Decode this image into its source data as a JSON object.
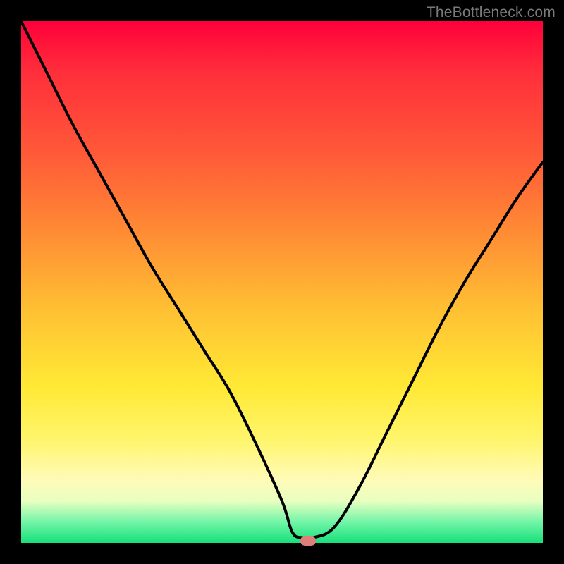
{
  "watermark": "TheBottleneck.com",
  "colors": {
    "curve_stroke": "#000000",
    "marker_fill": "#de7f79",
    "frame": "#000000"
  },
  "chart_data": {
    "type": "line",
    "title": "",
    "xlabel": "",
    "ylabel": "",
    "xlim": [
      0,
      100
    ],
    "ylim": [
      0,
      100
    ],
    "grid": false,
    "legend": false,
    "note": "Axes unlabeled in source image; x/y are estimated 0–100 percent scales read from pixel positions of the curve.",
    "series": [
      {
        "name": "bottleneck-curve",
        "x": [
          0,
          5,
          10,
          15,
          20,
          25,
          30,
          35,
          40,
          45,
          50,
          52,
          54,
          56,
          60,
          65,
          70,
          75,
          80,
          85,
          90,
          95,
          100
        ],
        "values": [
          100,
          90,
          80,
          71,
          62,
          53,
          45,
          37,
          29,
          19,
          8,
          2,
          1,
          1,
          3,
          11,
          21,
          31,
          41,
          50,
          58,
          66,
          73
        ]
      }
    ],
    "marker": {
      "x": 55,
      "y": 0
    },
    "background_gradient": {
      "stops": [
        {
          "pos": 0,
          "color": "#ff003a"
        },
        {
          "pos": 10,
          "color": "#ff2f3b"
        },
        {
          "pos": 25,
          "color": "#ff5838"
        },
        {
          "pos": 40,
          "color": "#ff8a34"
        },
        {
          "pos": 55,
          "color": "#ffbf33"
        },
        {
          "pos": 70,
          "color": "#ffe935"
        },
        {
          "pos": 80,
          "color": "#fff56a"
        },
        {
          "pos": 88,
          "color": "#fffbb8"
        },
        {
          "pos": 92,
          "color": "#e8ffc0"
        },
        {
          "pos": 96,
          "color": "#72f5a8"
        },
        {
          "pos": 100,
          "color": "#17e07a"
        }
      ]
    }
  }
}
